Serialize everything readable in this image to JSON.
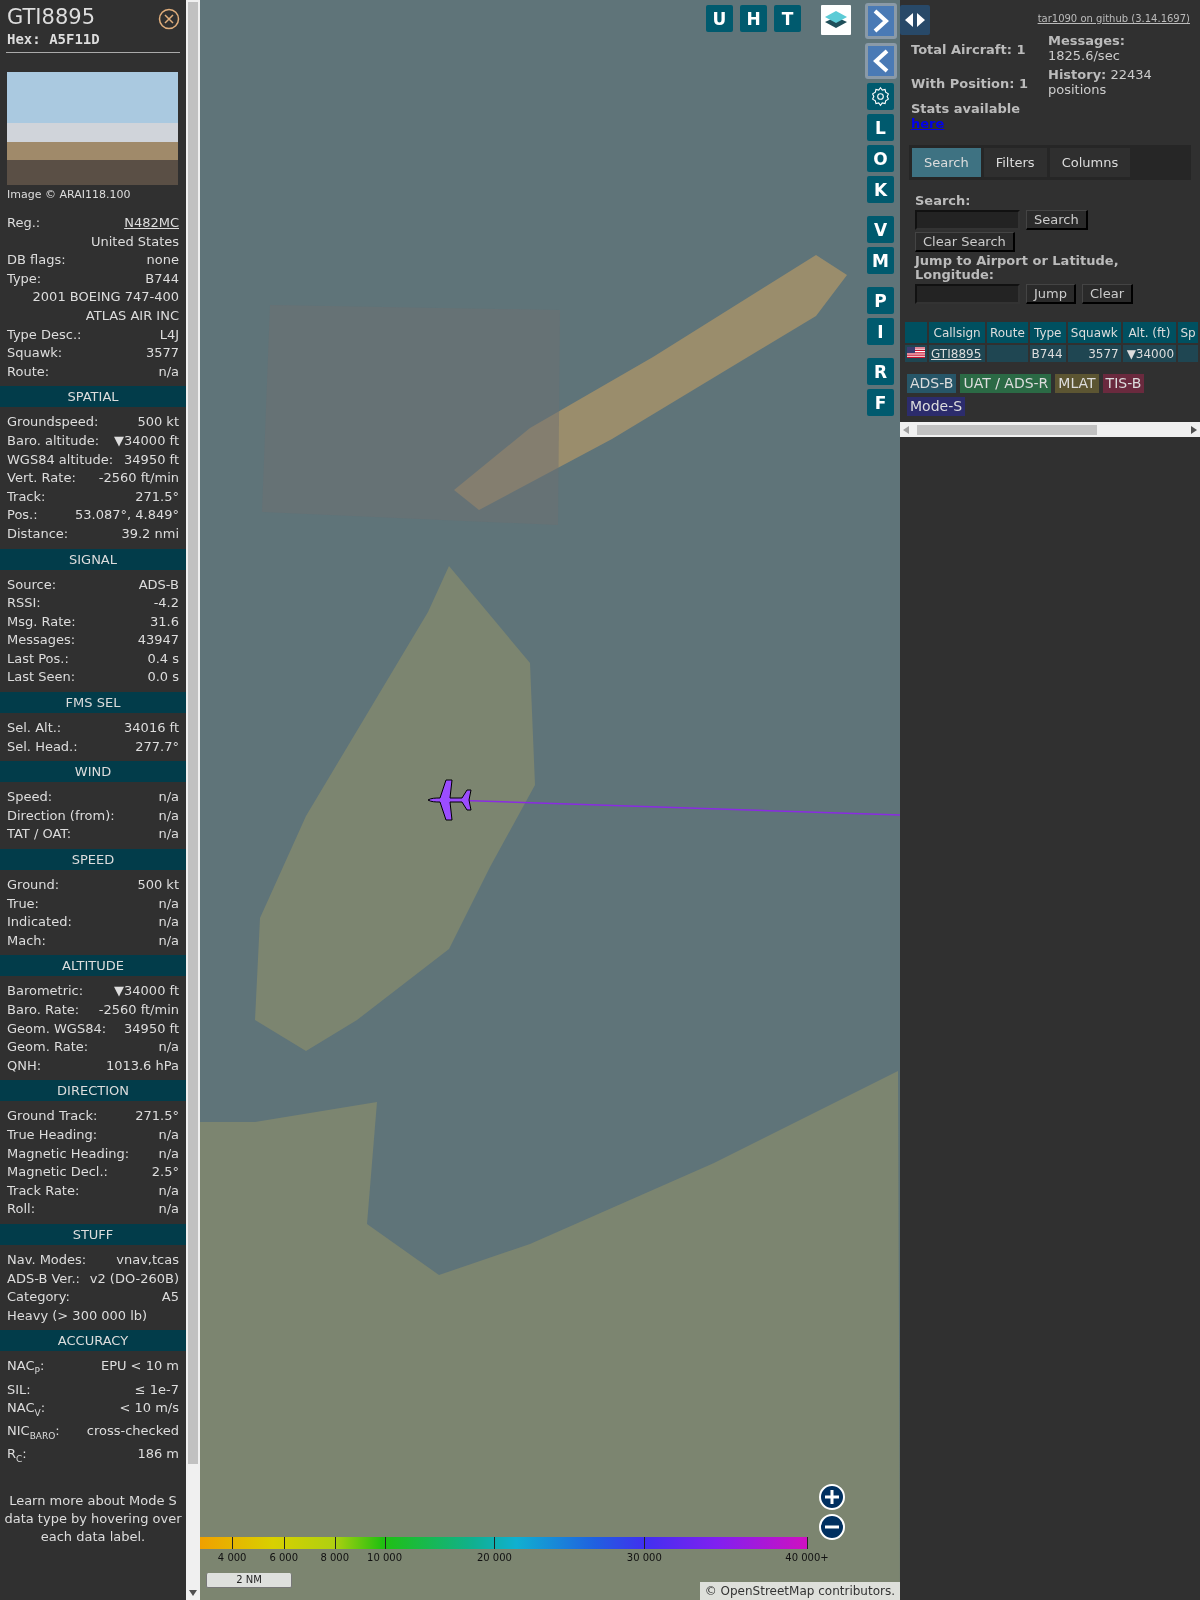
{
  "detail": {
    "callsign": "GTI8895",
    "hex": "Hex: A5F11D",
    "photo_credit": "Image © ARAI118.100",
    "sections": [
      {
        "rows": [
          {
            "kind": "link",
            "label": "Reg.:",
            "value": "N482MC"
          },
          {
            "kind": "value",
            "value": "United States"
          },
          {
            "kind": "pair",
            "label": "DB flags:",
            "value": "none"
          },
          {
            "kind": "pair",
            "label": "Type:",
            "value": "B744"
          },
          {
            "kind": "value",
            "value": "2001 BOEING 747-400"
          },
          {
            "kind": "value",
            "value": "ATLAS AIR INC"
          },
          {
            "kind": "pair",
            "label": "Type Desc.:",
            "value": "L4J"
          },
          {
            "kind": "pair",
            "label": "Squawk:",
            "value": "3577"
          },
          {
            "kind": "pair",
            "label": "Route:",
            "value": "n/a"
          }
        ]
      },
      {
        "title": "SPATIAL",
        "rows": [
          {
            "kind": "pair",
            "label": "Groundspeed:",
            "value": "500 kt"
          },
          {
            "kind": "pair",
            "label": "Baro. altitude:",
            "value": "▼34000 ft"
          },
          {
            "kind": "pair",
            "label": "WGS84 altitude:",
            "value": "34950 ft"
          },
          {
            "kind": "pair",
            "label": "Vert. Rate:",
            "value": "-2560 ft/min"
          },
          {
            "kind": "pair",
            "label": "Track:",
            "value": "271.5°"
          },
          {
            "kind": "pair",
            "label": "Pos.:",
            "value": "53.087°, 4.849°"
          },
          {
            "kind": "pair",
            "label": "Distance:",
            "value": "39.2 nmi"
          }
        ]
      },
      {
        "title": "SIGNAL",
        "rows": [
          {
            "kind": "pair",
            "label": "Source:",
            "value": "ADS-B"
          },
          {
            "kind": "pair",
            "label": "RSSI:",
            "value": "-4.2"
          },
          {
            "kind": "pair",
            "label": "Msg. Rate:",
            "value": "31.6"
          },
          {
            "kind": "pair",
            "label": "Messages:",
            "value": "43947"
          },
          {
            "kind": "pair",
            "label": "Last Pos.:",
            "value": "0.4 s"
          },
          {
            "kind": "pair",
            "label": "Last Seen:",
            "value": "0.0 s"
          }
        ]
      },
      {
        "title": "FMS SEL",
        "rows": [
          {
            "kind": "pair",
            "label": "Sel. Alt.:",
            "value": "34016 ft"
          },
          {
            "kind": "pair",
            "label": "Sel. Head.:",
            "value": "277.7°"
          }
        ]
      },
      {
        "title": "WIND",
        "rows": [
          {
            "kind": "pair",
            "label": "Speed:",
            "value": "n/a"
          },
          {
            "kind": "pair",
            "label": "Direction (from):",
            "value": "n/a"
          },
          {
            "kind": "pair",
            "label": "TAT / OAT:",
            "value": "n/a"
          }
        ]
      },
      {
        "title": "SPEED",
        "rows": [
          {
            "kind": "pair",
            "label": "Ground:",
            "value": "500 kt"
          },
          {
            "kind": "pair",
            "label": "True:",
            "value": "n/a"
          },
          {
            "kind": "pair",
            "label": "Indicated:",
            "value": "n/a"
          },
          {
            "kind": "pair",
            "label": "Mach:",
            "value": "n/a"
          }
        ]
      },
      {
        "title": "ALTITUDE",
        "rows": [
          {
            "kind": "pair",
            "label": "Barometric:",
            "value": "▼34000 ft"
          },
          {
            "kind": "pair",
            "label": "Baro. Rate:",
            "value": "-2560 ft/min"
          },
          {
            "kind": "pair",
            "label": "Geom. WGS84:",
            "value": "34950 ft"
          },
          {
            "kind": "pair",
            "label": "Geom. Rate:",
            "value": "n/a"
          },
          {
            "kind": "pair",
            "label": "QNH:",
            "value": "1013.6 hPa"
          }
        ]
      },
      {
        "title": "DIRECTION",
        "rows": [
          {
            "kind": "pair",
            "label": "Ground Track:",
            "value": "271.5°"
          },
          {
            "kind": "pair",
            "label": "True Heading:",
            "value": "n/a"
          },
          {
            "kind": "pair",
            "label": "Magnetic Heading:",
            "value": "n/a"
          },
          {
            "kind": "pair",
            "label": "Magnetic Decl.:",
            "value": "2.5°"
          },
          {
            "kind": "pair",
            "label": "Track Rate:",
            "value": "n/a"
          },
          {
            "kind": "pair",
            "label": "Roll:",
            "value": "n/a"
          }
        ]
      },
      {
        "title": "STUFF",
        "rows": [
          {
            "kind": "pair",
            "label": "Nav. Modes:",
            "value": "vnav,tcas"
          },
          {
            "kind": "pair",
            "label": "ADS-B Ver.:",
            "value": "v2 (DO-260B)"
          },
          {
            "kind": "pair",
            "label": "Category:",
            "value": "A5"
          },
          {
            "kind": "full",
            "label": "Heavy (> 300 000 lb)"
          }
        ]
      },
      {
        "title": "ACCURACY",
        "rows": [
          {
            "kind": "pair",
            "label": "NAC$_{P}$:",
            "value": "EPU < 10 m"
          },
          {
            "kind": "pair",
            "label": "SIL:",
            "value": "≤ 1e-7"
          },
          {
            "kind": "pair",
            "label": "NAC$_{V}$:",
            "value": "< 10 m/s"
          },
          {
            "kind": "pair",
            "label": "NIC$_{BARO}$:",
            "value": "cross-checked"
          },
          {
            "kind": "pair",
            "label": "R$_{C}$:",
            "value": "186 m"
          }
        ]
      }
    ],
    "note": "Learn more about Mode S data type by hovering over each data label."
  },
  "map": {
    "top_buttons": [
      {
        "kind": "letter",
        "label": "U"
      },
      {
        "kind": "letter",
        "label": "H"
      },
      {
        "kind": "letter",
        "label": "T"
      },
      {
        "kind": "layers"
      }
    ],
    "side_groups": [
      [
        {
          "kind": "forward"
        },
        {
          "kind": "back"
        },
        {
          "kind": "settings"
        },
        {
          "kind": "letter",
          "label": "L"
        },
        {
          "kind": "letter",
          "label": "O"
        },
        {
          "kind": "letter",
          "label": "K"
        }
      ],
      [
        {
          "kind": "letter",
          "label": "V"
        },
        {
          "kind": "letter",
          "label": "M"
        }
      ],
      [
        {
          "kind": "letter",
          "label": "P"
        },
        {
          "kind": "letter",
          "label": "I"
        }
      ],
      [
        {
          "kind": "letter",
          "label": "R"
        },
        {
          "kind": "letter",
          "label": "F"
        }
      ]
    ],
    "legend_ticks": [
      "4 000",
      "6 000",
      "8 000",
      "10 000",
      "20 000",
      "30 000",
      "40 000+"
    ],
    "scale": "2 NM",
    "attribution": {
      "prefix": "©",
      "link": "OpenStreetMap",
      "suffix": "contributors."
    }
  },
  "sidebar": {
    "repo_link": "tar1090 on github (3.14.1697)",
    "stats": [
      {
        "label": "Total Aircraft:",
        "value": "1"
      },
      {
        "label": "With Position:",
        "value": "1"
      }
    ],
    "stats_text": "Stats available",
    "stats_link": "here",
    "messages": {
      "label": "Messages:",
      "value": "1825.6/sec"
    },
    "history": {
      "label": "History:",
      "value": "22434 positions"
    },
    "tabs": [
      {
        "label": "Search",
        "selected": true
      },
      {
        "label": "Filters",
        "selected": false
      },
      {
        "label": "Columns",
        "selected": false
      }
    ],
    "search": {
      "label": "Search:",
      "button": "Search",
      "clear_button": "Clear Search",
      "jump_label": "Jump to Airport or Latitude, Longitude:",
      "jump_button": "Jump",
      "jump_clear": "Clear"
    },
    "table": {
      "columns": [
        "Callsign",
        "Route",
        "Type",
        "Squawk",
        "Alt. (ft)",
        "Sp"
      ],
      "rows": [
        {
          "callsign": "GTI8895",
          "type": "B744",
          "squawk": "3577",
          "altitude": "▼34000"
        }
      ]
    },
    "sources": [
      {
        "label": "ADS-B",
        "color": "#275668"
      },
      {
        "label": "UAT / ADS-R",
        "color": "#2b6a45"
      },
      {
        "label": "MLAT",
        "color": "#5c5532"
      },
      {
        "label": "TIS-B",
        "color": "#6a2a3e"
      },
      {
        "label": "Mode-S",
        "color": "#2c2c6c"
      }
    ]
  }
}
